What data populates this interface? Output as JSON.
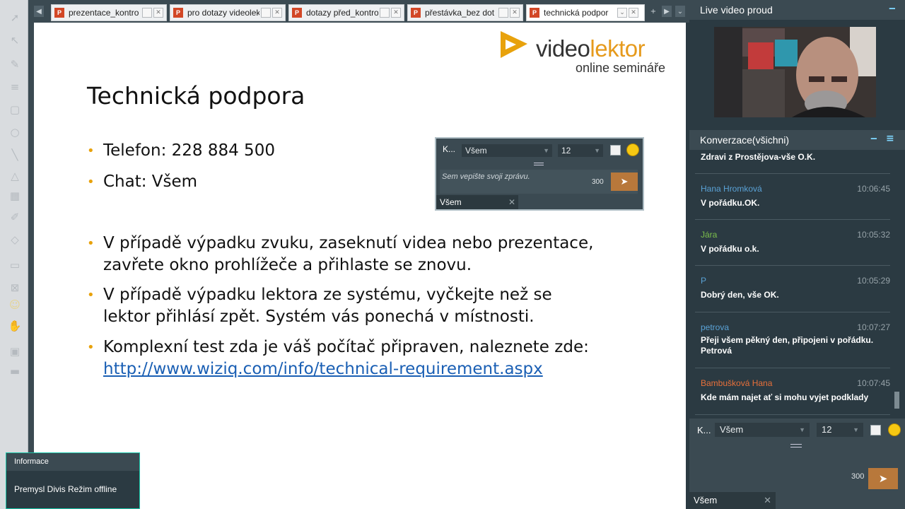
{
  "tabs": [
    {
      "label": "prezentace_kontro",
      "active": false
    },
    {
      "label": "pro dotazy videolek",
      "active": false
    },
    {
      "label": "dotazy před_kontro",
      "active": false
    },
    {
      "label": "přestávka_bez dot",
      "active": false
    },
    {
      "label": "technická podpor",
      "active": true
    }
  ],
  "tab_icon": "P",
  "slide": {
    "logo_prefix": "video",
    "logo_accent": "lektor",
    "logo_sub": "online semináře",
    "title": "Technická podpora",
    "bullets": [
      "Telefon: 228 884 500",
      "Chat: Všem",
      "V případě výpadku zvuku, zaseknutí videa nebo prezentace, zavřete okno prohlížeče a přihlaste se znovu.",
      "V případě výpadku lektora ze systému, vyčkejte než se lektor přihlásí zpět. Systém vás ponechá v místnosti.",
      "Komplexní test zda je váš počítač připraven, naleznete zde:"
    ],
    "link": "http://www.wiziq.com/info/technical-requirement.aspx",
    "mini_chat": {
      "k_label": "K...",
      "recipient": "Všem",
      "font_size": "12",
      "placeholder": "Sem vepište svoji zprávu.",
      "char_count": "300",
      "tab_label": "Všem"
    }
  },
  "info_panel": {
    "heading": "Informace",
    "text": "Premysl Divis Režim offline"
  },
  "video_panel": {
    "title": "Live video proud"
  },
  "chat_panel": {
    "title": "Konverzace(všichni)",
    "messages": [
      {
        "name": "",
        "time": "",
        "text": "Zdravi z Prostějova-vše O.K.",
        "color": "#ffffff"
      },
      {
        "name": "Hana Hromková",
        "time": "10:06:45",
        "text": "V pořádku.OK.",
        "color": "#5aa2d6"
      },
      {
        "name": "Jára",
        "time": "10:05:32",
        "text": "V pořádku o.k.",
        "color": "#7cbf4c"
      },
      {
        "name": "P",
        "time": "10:05:29",
        "text": "Dobrý den, vše OK.",
        "color": "#5aa2d6"
      },
      {
        "name": "petrova",
        "time": "10:07:27",
        "text": "Přeji všem pěkný den,  připojeni v pořádku. Petrová",
        "color": "#5aa2d6"
      },
      {
        "name": "Bambušková Hana",
        "time": "10:07:45",
        "text": "Kde mám najet ať si mohu vyjet podklady",
        "color": "#e8703a"
      }
    ],
    "compose": {
      "k_label": "K...",
      "recipient": "Všem",
      "font_size": "12",
      "char_count": "300",
      "tab_label": "Všem"
    }
  },
  "colors": {
    "accent_orange": "#e8a20c",
    "send_button": "#b8783b",
    "panel_dark": "#2b3a42"
  }
}
